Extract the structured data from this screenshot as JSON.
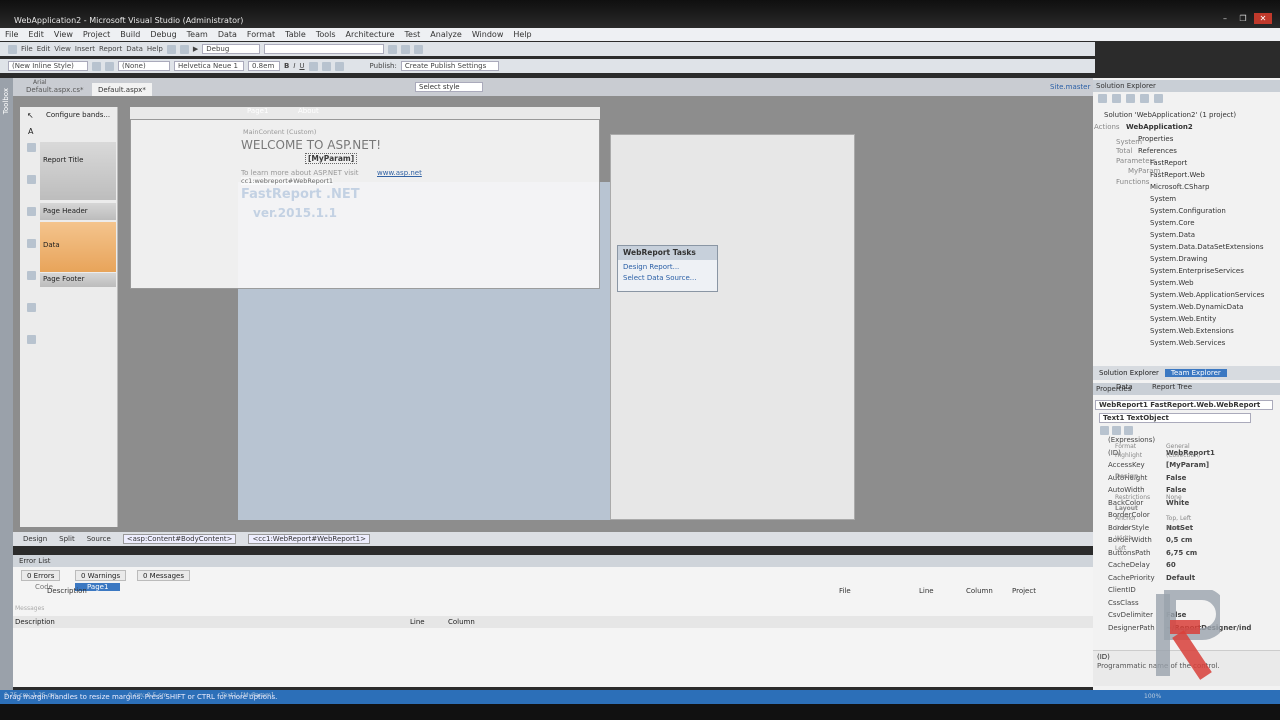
{
  "window": {
    "title": "WebApplication2 - Microsoft Visual Studio (Administrator)"
  },
  "menu": [
    "File",
    "Edit",
    "View",
    "Project",
    "Build",
    "Debug",
    "Team",
    "Data",
    "Format",
    "Table",
    "Tools",
    "Architecture",
    "Test",
    "Analyze",
    "Window",
    "Help"
  ],
  "toolbar1": {
    "items": [
      "File",
      "Edit",
      "View",
      "Insert",
      "Report",
      "Data",
      "Help"
    ],
    "config": "Debug",
    "publish_label": "Publish:",
    "publish_value": "Create Publish Settings"
  },
  "toolbar2": {
    "style": "(New Inline Style)",
    "block": "(None)",
    "font": "Helvetica Neue 1",
    "size": "0.8em"
  },
  "toolbar3": {
    "font": "Arial",
    "select_style": "Select style"
  },
  "doc_tabs": [
    "Default.aspx.cs*",
    "Default.aspx*"
  ],
  "toolbox_label": "Toolbox",
  "site_master": "Site.master",
  "designer": {
    "configure_bands": "Configure bands...",
    "bands": [
      "Report Title",
      "Page Header",
      "Data",
      "Page Footer"
    ],
    "tabs": [
      "Page1",
      "About"
    ],
    "main_content": "MainContent (Custom)",
    "welcome": "WELCOME TO ASP.NET!",
    "param": "[MyParam]",
    "learn_more": "To learn more about ASP.NET visit",
    "link": "www.asp.net",
    "control_tag": "cc1:webreport#WebReport1",
    "fr_name": "FastReport .NET",
    "fr_ver": "ver.2015.1.1"
  },
  "tasks": {
    "title": "WebReport Tasks",
    "items": [
      "Design Report...",
      "Select Data Source..."
    ]
  },
  "viewbar": {
    "design": "Design",
    "split": "Split",
    "source": "Source",
    "crumbs": [
      "<asp:Content#BodyContent>",
      "<cc1:WebReport#WebReport1>"
    ]
  },
  "error_list": {
    "title": "Error List",
    "tabs": [
      "0 Errors",
      "0 Warnings",
      "0 Messages"
    ],
    "sub_tabs": [
      "Code",
      "Page1"
    ],
    "cols": [
      "Description",
      "File",
      "Line",
      "Column",
      "Project"
    ],
    "messages_label": "Messages",
    "cols2": [
      "Description",
      "Line",
      "Column"
    ]
  },
  "status": {
    "text": "Drag margin handles to resize margins. Press SHIFT or CTRL for more options.",
    "left": "0.75 cm; 1.25 cm",
    "mid": "0 cm; 0.5 cm",
    "sel": "Text1: [MyParam]",
    "zoom": "100%"
  },
  "solution": {
    "title": "Solution Explorer",
    "items": [
      "Solution 'WebApplication2' (1 project)",
      "WebApplication2",
      "Properties",
      "References",
      "FastReport",
      "FastReport.Web",
      "Microsoft.CSharp",
      "System",
      "System.Configuration",
      "System.Core",
      "System.Data",
      "System.Data.DataSetExtensions",
      "System.Drawing",
      "System.EnterpriseServices",
      "System.Web",
      "System.Web.ApplicationServices",
      "System.Web.DynamicData",
      "System.Web.Entity",
      "System.Web.Extensions",
      "System.Web.Services"
    ],
    "overlay": [
      "Actions",
      "System",
      "Total",
      "Parameters",
      "MyParam",
      "Functions"
    ],
    "tabs": [
      "Solution Explorer",
      "Team Explorer"
    ]
  },
  "data_tabs": [
    "Data",
    "Report Tree"
  ],
  "properties": {
    "title": "Properties",
    "object": "WebReport1  FastReport.Web.WebReport",
    "object2": "Text1  TextObject",
    "rows": [
      [
        "(Expressions)",
        ""
      ],
      [
        "(ID)",
        "WebReport1"
      ],
      [
        "AccessKey",
        "[MyParam]"
      ],
      [
        "AutoHeight",
        "False"
      ],
      [
        "AutoWidth",
        "False"
      ],
      [
        "BackColor",
        "White"
      ],
      [
        "BorderColor",
        ""
      ],
      [
        "BorderStyle",
        "NotSet"
      ],
      [
        "BorderWidth",
        "0,5 cm"
      ],
      [
        "ButtonsPath",
        "6,75 cm"
      ],
      [
        "CacheDelay",
        "60"
      ],
      [
        "CachePriority",
        "Default"
      ],
      [
        "ClientID",
        ""
      ],
      [
        "CssClass",
        ""
      ],
      [
        "CsvDelimiter",
        "False"
      ],
      [
        "DesignerPath",
        "~/ReportDesigner/ind"
      ]
    ],
    "overlay": [
      "Format",
      "General",
      "Highlight",
      "(Collection)",
      "Design",
      "Restrictions",
      "None",
      "Layout",
      "Anchor",
      "Top, Left",
      "Dock",
      "None",
      "Left",
      "Width"
    ],
    "desc_title": "(ID)",
    "desc_text": "Programmatic name of the control."
  }
}
